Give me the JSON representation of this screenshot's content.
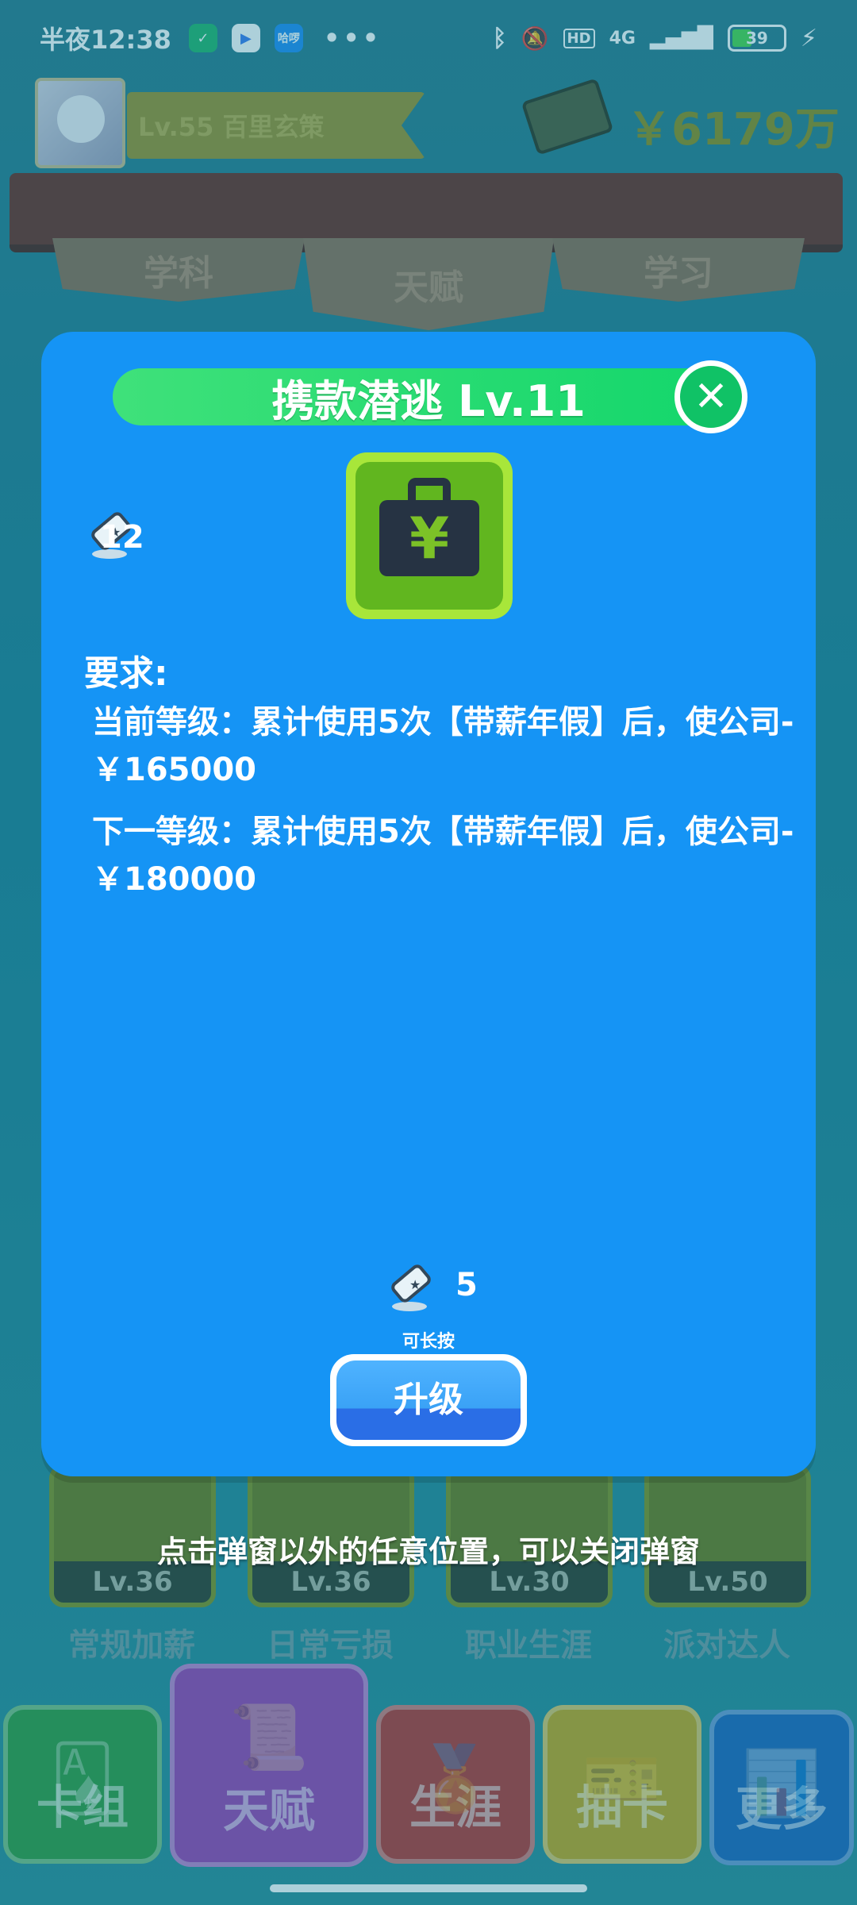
{
  "status_bar": {
    "time": "半夜12:38",
    "app1": "✓",
    "app2": "▶",
    "app3": "哈啰",
    "more": "•••",
    "network": "4G",
    "hd": "HD",
    "battery": "39"
  },
  "header": {
    "level_name": "Lv.55 百里玄策",
    "money": "￥6179万"
  },
  "top_tabs": [
    "学科",
    "天赋",
    "学习"
  ],
  "skills": [
    {
      "level": "Lv.36",
      "name": "常规加薪"
    },
    {
      "level": "Lv.36",
      "name": "日常亏损"
    },
    {
      "level": "Lv.30",
      "name": "职业生涯"
    },
    {
      "level": "Lv.50",
      "name": "派对达人"
    }
  ],
  "bottom_nav": [
    "卡组",
    "天赋",
    "生涯",
    "抽卡",
    "更多"
  ],
  "dialog": {
    "title": "携款潜逃 Lv.11",
    "icon_symbol": "¥",
    "scroll_count": "12",
    "requirement_title": "要求:",
    "current_level": "当前等级：累计使用5次【带薪年假】后，使公司-￥165000",
    "next_level": "下一等级：累计使用5次【带薪年假】后，使公司-￥180000",
    "cost": "5",
    "hold_hint": "可长按",
    "upgrade_label": "升级",
    "close_symbol": "✕"
  },
  "dismiss_hint": "点击弹窗以外的任意位置，可以关闭弹窗",
  "colors": {
    "dialog_bg": "#1594f5",
    "title_pill": "#3fe17a",
    "upgrade_button": "#3aa2f6"
  }
}
